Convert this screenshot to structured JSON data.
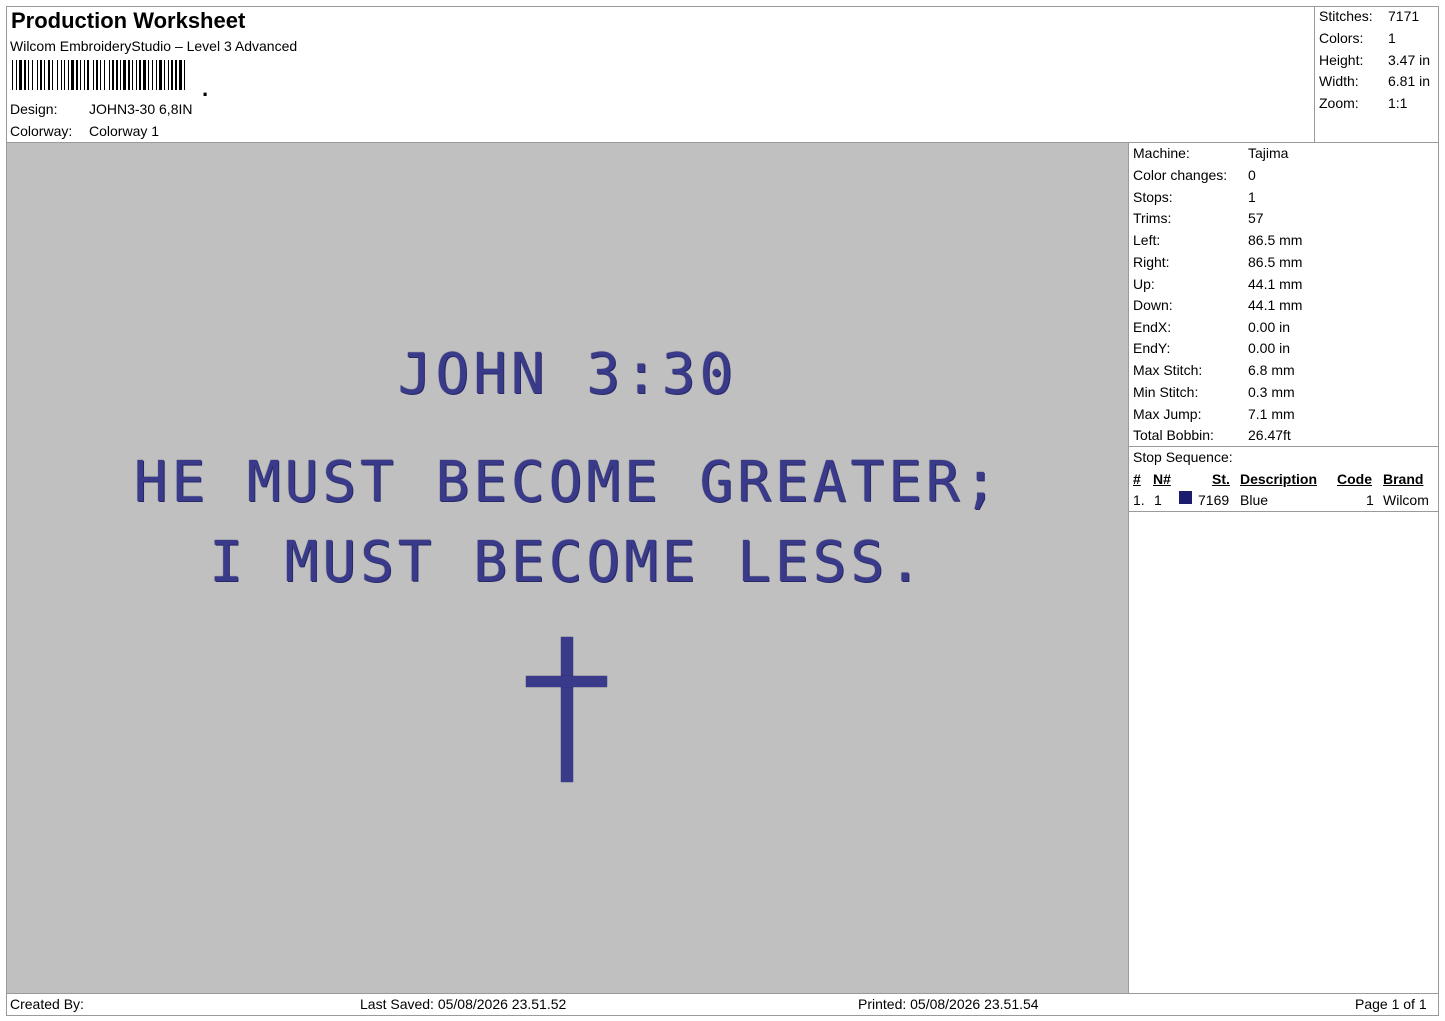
{
  "header": {
    "title": "Production Worksheet",
    "subtitle": "Wilcom EmbroideryStudio – Level 3 Advanced",
    "design_label": "Design:",
    "design_value": "JOHN3-30 6,8IN",
    "colorway_label": "Colorway:",
    "colorway_value": "Colorway 1"
  },
  "summary": [
    {
      "label": "Stitches:",
      "value": "7171"
    },
    {
      "label": "Colors:",
      "value": "1"
    },
    {
      "label": "Height:",
      "value": "3.47 in"
    },
    {
      "label": "Width:",
      "value": "6.81 in"
    },
    {
      "label": "Zoom:",
      "value": "1:1"
    }
  ],
  "details": [
    {
      "label": "Machine:",
      "value": "Tajima"
    },
    {
      "label": "Color changes:",
      "value": "0"
    },
    {
      "label": "Stops:",
      "value": "1"
    },
    {
      "label": "Trims:",
      "value": "57"
    },
    {
      "label": "Left:",
      "value": "86.5 mm"
    },
    {
      "label": "Right:",
      "value": "86.5 mm"
    },
    {
      "label": "Up:",
      "value": "44.1 mm"
    },
    {
      "label": "Down:",
      "value": "44.1 mm"
    },
    {
      "label": "EndX:",
      "value": "0.00 in"
    },
    {
      "label": "EndY:",
      "value": "0.00 in"
    },
    {
      "label": "Max Stitch:",
      "value": "6.8 mm"
    },
    {
      "label": "Min Stitch:",
      "value": "0.3 mm"
    },
    {
      "label": "Max Jump:",
      "value": "7.1 mm"
    },
    {
      "label": "Total Bobbin:",
      "value": "26.47ft"
    }
  ],
  "stop_sequence": {
    "title": "Stop Sequence:",
    "columns": [
      "#",
      "N#",
      "St.",
      "Description",
      "Code",
      "Brand"
    ],
    "rows": [
      {
        "num": "1.",
        "n": "1",
        "st": "7169",
        "description": "Blue",
        "code": "1",
        "brand": "Wilcom",
        "color": "#1c1c6e"
      }
    ]
  },
  "design": {
    "line1": "JOHN 3:30",
    "line2": "HE MUST BECOME GREATER;",
    "line3": "I MUST BECOME LESS.",
    "thread_color": "#3a3a8a",
    "background_color": "#c0c0c0"
  },
  "footer": {
    "created_by": "Created By:",
    "last_saved": "Last Saved: 05/08/2026 23.51.52",
    "printed": "Printed: 05/08/2026 23.51.54",
    "page": "Page 1 of 1"
  }
}
